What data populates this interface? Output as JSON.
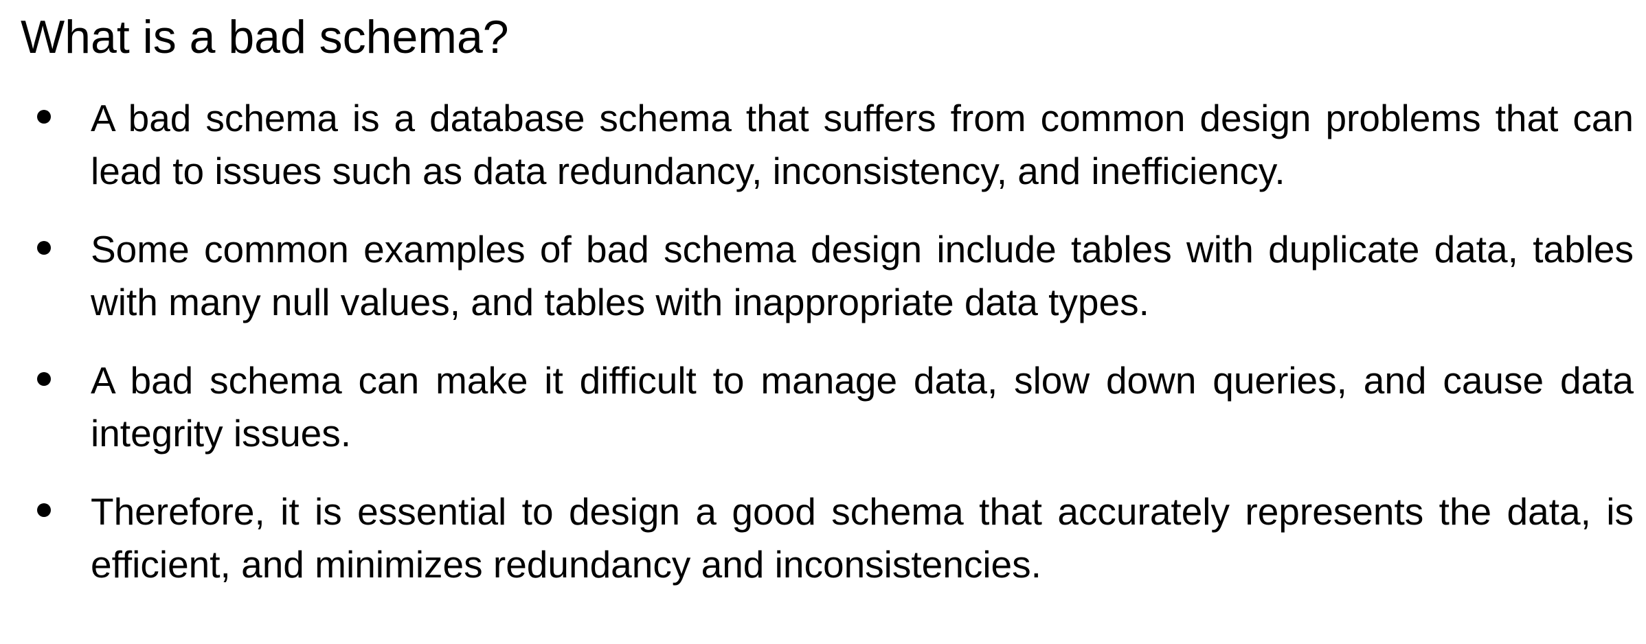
{
  "slide": {
    "title": "What is a bad schema?",
    "bullet_icon": "bullet-dot-icon",
    "bullets": [
      {
        "text": "A bad schema is a database schema that suffers from common design problems that can lead to issues such as data redundancy, inconsistency, and inefficiency."
      },
      {
        "text": "Some common examples of bad schema design include tables with duplicate data, tables with many null values, and tables with inappropriate data types."
      },
      {
        "text": "A bad schema can make it difficult to manage data, slow down queries, and cause data integrity issues."
      },
      {
        "text": "Therefore, it is essential to design a good schema that accurately represents the data, is efficient, and minimizes redundancy and inconsistencies."
      }
    ]
  }
}
